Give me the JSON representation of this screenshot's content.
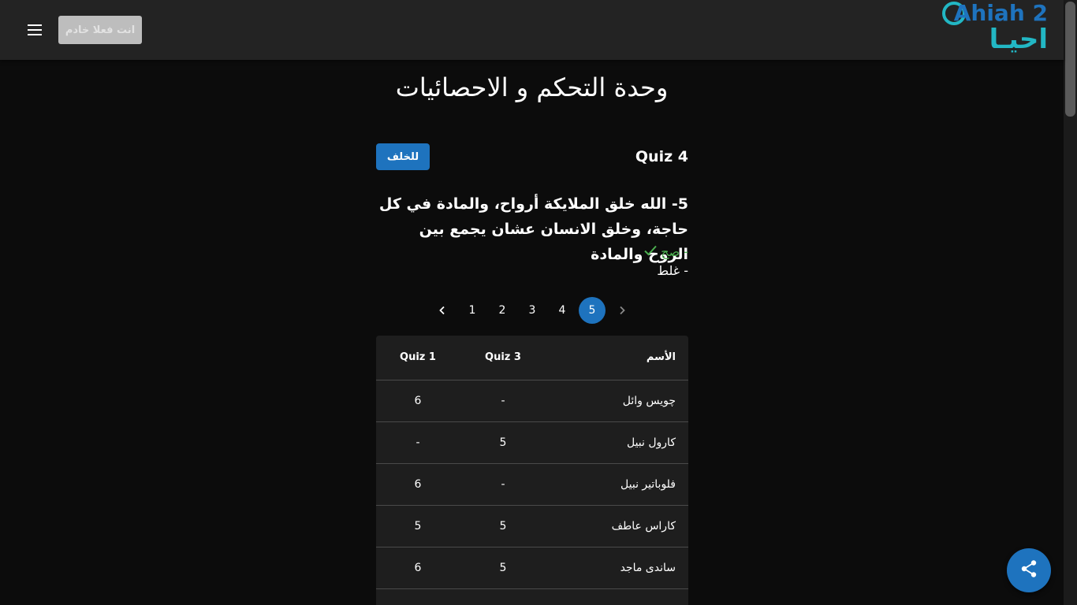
{
  "header": {
    "status_label": "انت فعلا خادم",
    "logo": {
      "latin_text": "Ahiah 2",
      "arabic_text": "احيـا"
    }
  },
  "page": {
    "title": "وحدة التحكم و الاحصائيات"
  },
  "quiz": {
    "title": "Quiz 4",
    "back_label": "للخلف",
    "question": "5- الله خلق الملايكة أرواح، والمادة في كل حاجة، وخلق الانسان عشان يجمع بين الروح والمادة",
    "answers": [
      {
        "label": "- صح",
        "correct": true
      },
      {
        "label": "- غلط",
        "correct": false
      }
    ]
  },
  "pagination": {
    "pages": [
      "1",
      "2",
      "3",
      "4",
      "5"
    ],
    "current": "5"
  },
  "table": {
    "headers": {
      "name": "الأسم",
      "q3": "Quiz 3",
      "q1": "Quiz 1"
    },
    "rows": [
      {
        "name": "چويس وائل",
        "q3": "-",
        "q1": "6"
      },
      {
        "name": "كارول نبيل",
        "q3": "5",
        "q1": "-"
      },
      {
        "name": "فلوباتير نبيل",
        "q3": "-",
        "q1": "6"
      },
      {
        "name": "كاراس عاطف",
        "q3": "5",
        "q1": "5"
      },
      {
        "name": "ساندى ماجد",
        "q3": "5",
        "q1": "6"
      },
      {
        "name": "",
        "q3": "",
        "q1": ""
      }
    ]
  },
  "colors": {
    "accent": "#1e73be",
    "correct": "#4caf50",
    "logo_teal": "#22b7c4",
    "background": "#0c0c0c",
    "topbar": "#232323"
  },
  "icons": {
    "menu": "menu-icon",
    "check": "check-icon",
    "share": "share-icon",
    "prev": "chevron-left-icon",
    "next": "chevron-right-icon"
  }
}
